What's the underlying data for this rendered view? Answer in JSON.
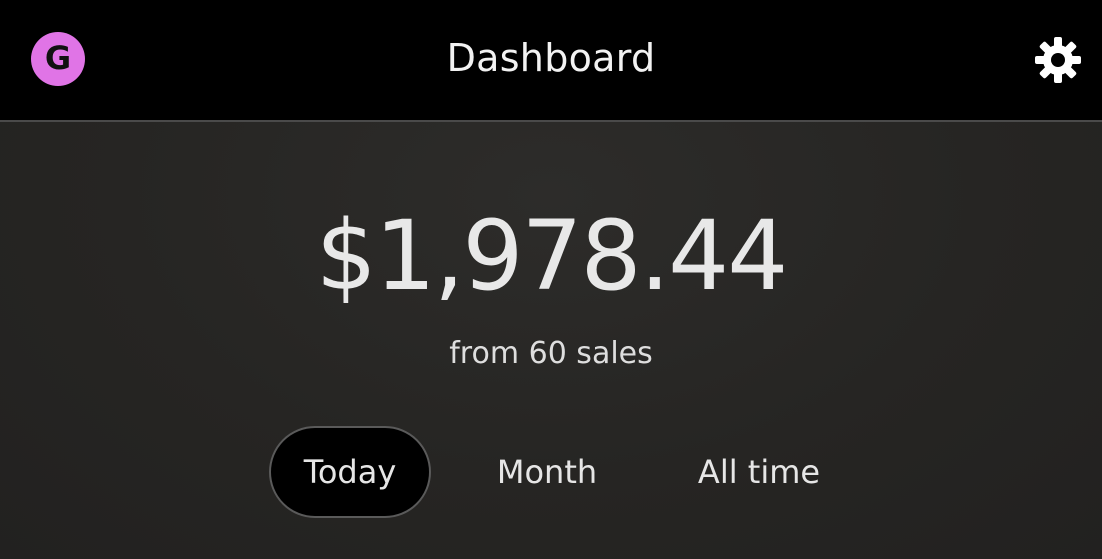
{
  "header": {
    "avatar_letter": "G",
    "title": "Dashboard",
    "settings_icon": "gear-icon"
  },
  "summary": {
    "amount": "$1,978.44",
    "subtext": "from 60 sales"
  },
  "tabs": [
    {
      "label": "Today",
      "selected": true
    },
    {
      "label": "Month",
      "selected": false
    },
    {
      "label": "All time",
      "selected": false
    }
  ],
  "colors": {
    "header_bg": "#000000",
    "body_bg": "#252422",
    "avatar": "#e074e6",
    "text": "#e8e8e8"
  }
}
